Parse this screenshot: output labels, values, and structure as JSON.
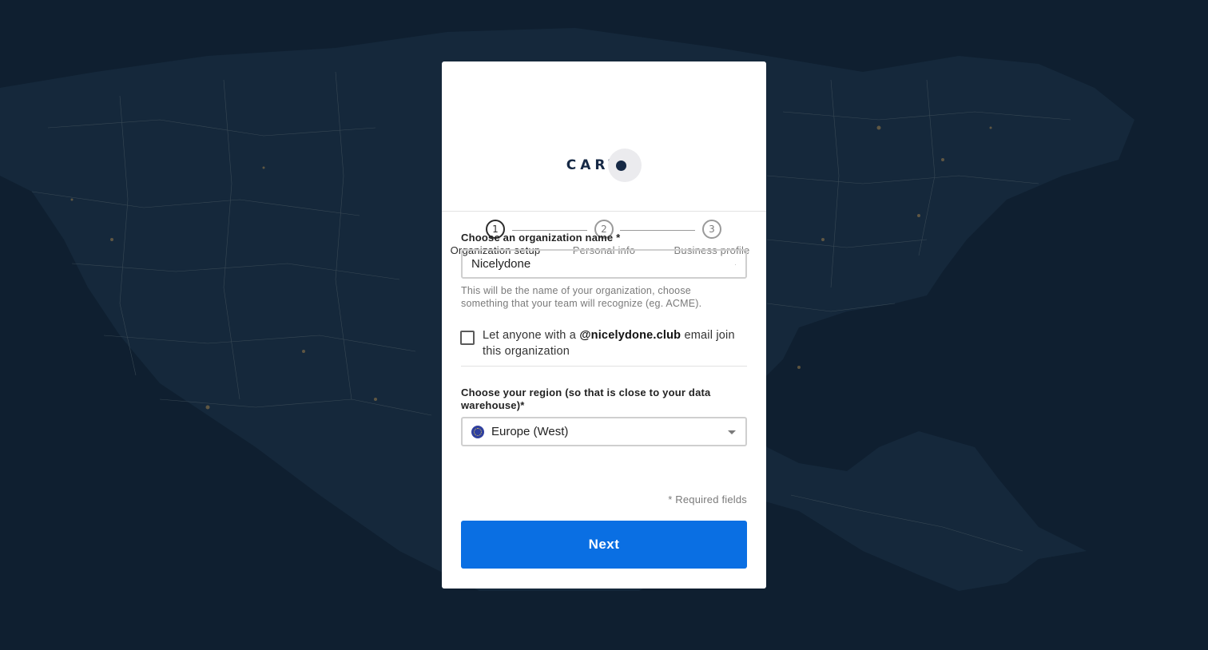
{
  "brand": {
    "logo_text": "CART"
  },
  "stepper": {
    "steps": [
      {
        "number": "1",
        "label": "Organization setup",
        "state": "active"
      },
      {
        "number": "2",
        "label": "Personal info",
        "state": "upcoming"
      },
      {
        "number": "3",
        "label": "Business profile",
        "state": "upcoming"
      }
    ]
  },
  "form": {
    "org_name": {
      "label": "Choose an organization name *",
      "value": "Nicelydone",
      "helper": "This will be the name of your organization, choose something that your team will recognize (eg. ACME)."
    },
    "domain_join": {
      "text_before": "Let anyone with a",
      "domain": "@nicelydone.club",
      "text_after": "email join this organization",
      "checked": false
    },
    "region": {
      "label": "Choose your region (so that is close to your data warehouse)*",
      "value": "Europe (West)",
      "icon": "eu-flag-icon"
    },
    "required_note": "* Required fields",
    "next_label": "Next"
  },
  "colors": {
    "background": "#0f1f30",
    "primary": "#0a6fe3",
    "logo": "#162945"
  }
}
